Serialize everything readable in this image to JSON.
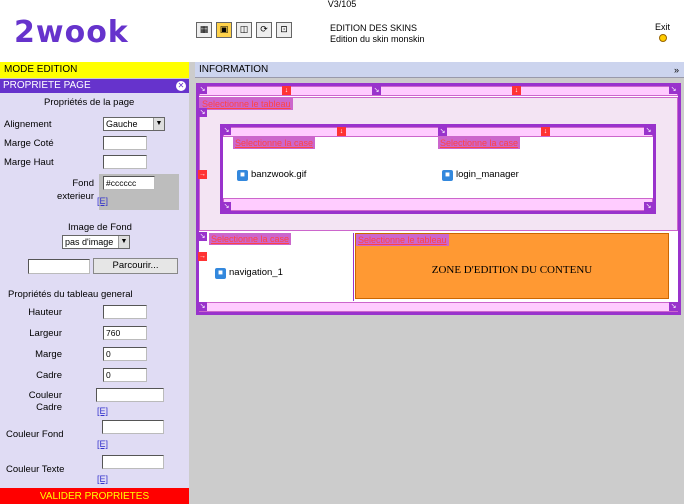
{
  "header": {
    "version": "V3/105",
    "logo": "2wook",
    "title": "EDITION DES SKINS",
    "subtitle": "Edition du skin monskin",
    "exit_label": "Exit",
    "tools": [
      {
        "icon": "layout-icon",
        "glyph": "▦"
      },
      {
        "icon": "box-icon",
        "glyph": "▣"
      },
      {
        "icon": "images-icon",
        "glyph": "◫"
      },
      {
        "icon": "refresh-icon",
        "glyph": "⟳"
      },
      {
        "icon": "zoom-icon",
        "glyph": "⊡"
      }
    ]
  },
  "left": {
    "mode_label": "MODE EDITION",
    "panel_title": "PROPRIETE PAGE",
    "page_props_title": "Propriétés de la page",
    "align_label": "Alignement",
    "align_value": "Gauche",
    "marge_cote_label": "Marge Coté",
    "marge_cote_value": "",
    "marge_haut_label": "Marge Haut",
    "marge_haut_value": "",
    "fond_label": "Fond",
    "fond_value": "#cccccc",
    "exterieur_label": "exterieur",
    "e_link": "[E]",
    "image_fond_label": "Image de Fond",
    "image_fond_value": "pas d'image",
    "file_value": "",
    "browse_label": "Parcourir...",
    "table_props_title": "Propriétés du tableau general",
    "hauteur_label": "Hauteur",
    "hauteur_value": "",
    "largeur_label": "Largeur",
    "largeur_value": "760",
    "marge_label": "Marge",
    "marge_value": "0",
    "cadre_label": "Cadre",
    "cadre_value": "0",
    "couleur_label": "Couleur",
    "cadre2_label": "Cadre",
    "couleur_cadre_value": "",
    "couleur_fond_label": "Couleur Fond",
    "couleur_fond_value": "",
    "couleur_texte_label": "Couleur Texte",
    "couleur_texte_value": "",
    "validate_label": "VALIDER PROPRIETES"
  },
  "right": {
    "info_label": "INFORMATION",
    "select_table": "Selectionne le tableau",
    "select_cell": "Selectionne la case",
    "cells": {
      "banner": "banzwook.gif",
      "login": "login_manager",
      "nav": "navigation_1",
      "zone": "ZONE D'EDITION DU CONTENU"
    }
  },
  "colors": {
    "accent": "#6633cc",
    "frame": "#9933cc",
    "mode": "#ffff00",
    "content_zone": "#ff9933",
    "validate": "#ff0000"
  }
}
